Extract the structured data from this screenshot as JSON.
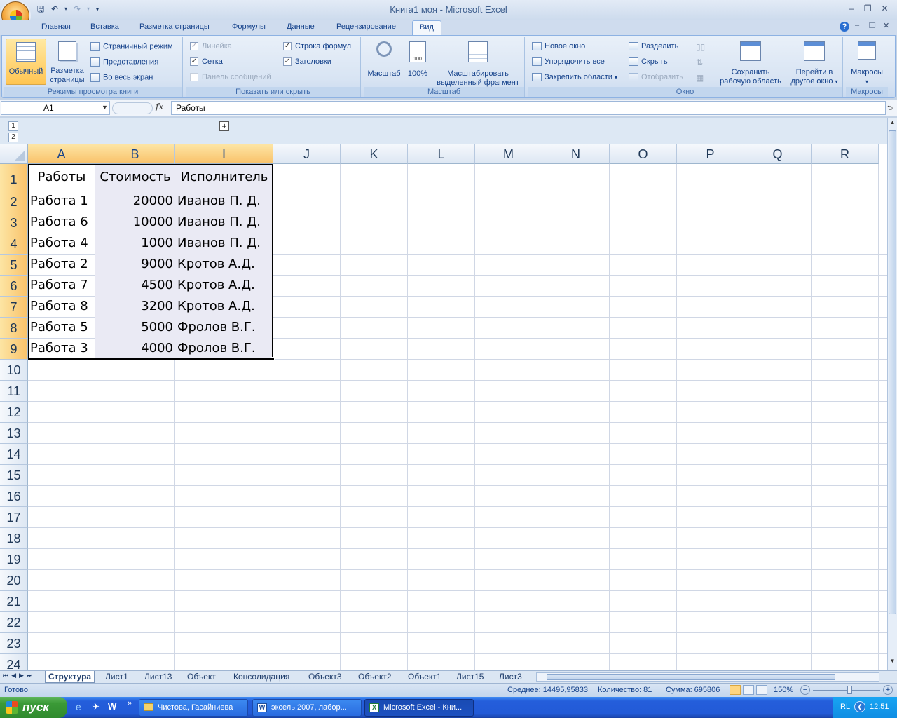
{
  "window": {
    "title": "Книга1 моя - Microsoft Excel"
  },
  "qat": {
    "icons": [
      "save-icon",
      "undo-icon",
      "redo-icon",
      "customize-icon"
    ]
  },
  "tabs": [
    "Главная",
    "Вставка",
    "Разметка страницы",
    "Формулы",
    "Данные",
    "Рецензирование",
    "Вид"
  ],
  "ribbon": {
    "views": {
      "label": "Режимы просмотра книги",
      "normal": "Обычный",
      "page_layout_1": "Разметка",
      "page_layout_2": "страницы",
      "page_break": "Страничный режим",
      "custom_views": "Представления",
      "full_screen": "Во весь экран"
    },
    "show": {
      "label": "Показать или скрыть",
      "ruler": "Линейка",
      "gridlines": "Сетка",
      "message_bar": "Панель сообщений",
      "formula_bar": "Строка формул",
      "headings": "Заголовки"
    },
    "zoom": {
      "label": "Масштаб",
      "zoom": "Масштаб",
      "hundred": "100%",
      "zoom_sel_1": "Масштабировать",
      "zoom_sel_2": "выделенный фрагмент"
    },
    "window": {
      "label": "Окно",
      "new_window": "Новое окно",
      "arrange_all": "Упорядочить все",
      "freeze": "Закрепить области",
      "split": "Разделить",
      "hide": "Скрыть",
      "unhide": "Отобразить",
      "save_ws_1": "Сохранить",
      "save_ws_2": "рабочую область",
      "switch_1": "Перейти в",
      "switch_2": "другое окно"
    },
    "macros": {
      "label": "Макросы",
      "macros": "Макросы"
    }
  },
  "formula": {
    "name_box": "A1",
    "fx": "fx",
    "value": "Работы"
  },
  "outline": {
    "levels": [
      "1",
      "2"
    ],
    "expand": "+"
  },
  "columns": [
    "A",
    "B",
    "I",
    "J",
    "K",
    "L",
    "M",
    "N",
    "O",
    "P",
    "Q",
    "R"
  ],
  "rows": [
    "1",
    "2",
    "3",
    "4",
    "5",
    "6",
    "7",
    "8",
    "9",
    "10",
    "11",
    "12",
    "13",
    "14",
    "15",
    "16",
    "17",
    "18",
    "19",
    "20",
    "21",
    "22",
    "23",
    "24"
  ],
  "table": {
    "header": [
      "Работы",
      "Стоимость",
      "Исполнитель"
    ],
    "rows": [
      [
        "Работа 1",
        "20000",
        "Иванов П. Д."
      ],
      [
        "Работа 6",
        "10000",
        "Иванов П. Д."
      ],
      [
        "Работа 4",
        "1000",
        "Иванов П. Д."
      ],
      [
        "Работа 2",
        "9000",
        "Кротов А.Д."
      ],
      [
        "Работа 7",
        "4500",
        "Кротов А.Д."
      ],
      [
        "Работа 8",
        "3200",
        "Кротов А.Д."
      ],
      [
        "Работа 5",
        "5000",
        "Фролов В.Г."
      ],
      [
        "Работа 3",
        "4000",
        "Фролов В.Г."
      ]
    ]
  },
  "sheets": [
    "Структура",
    "Лист1",
    "Лист13",
    "Объект",
    "Консолидация",
    "Объект3",
    "Объект2",
    "Объект1",
    "Лист15",
    "Лист3"
  ],
  "status": {
    "ready": "Готово",
    "average": "Среднее: 14495,95833",
    "count": "Количество: 81",
    "sum": "Сумма: 695806",
    "zoom": "150%"
  },
  "taskbar": {
    "start": "пуск",
    "items": [
      "Чистова, Гасайниева",
      "эксель 2007, лабор...",
      "Microsoft Excel - Кни..."
    ],
    "lang": "RL",
    "clock": "12:51"
  }
}
